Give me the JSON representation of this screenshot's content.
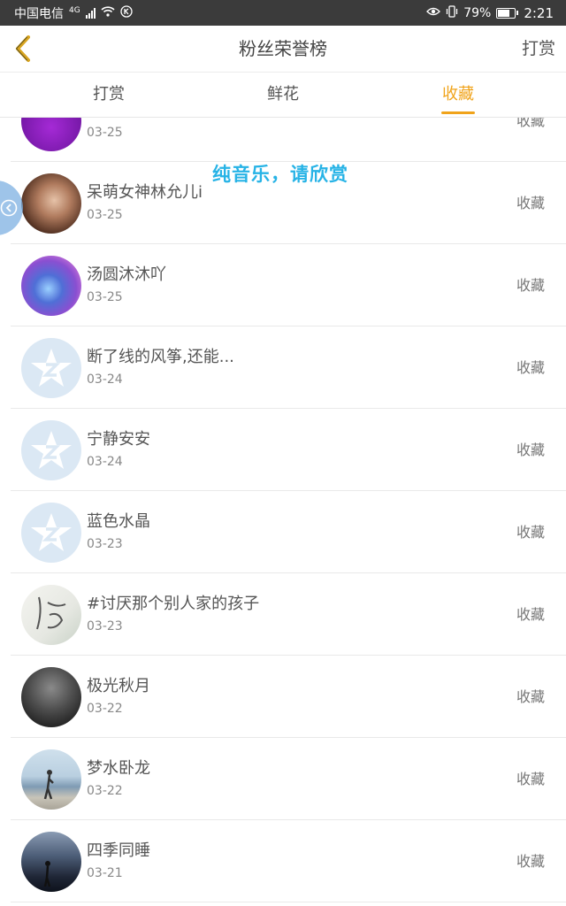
{
  "status_bar": {
    "carrier": "中国电信",
    "network": "4G",
    "battery": "79%",
    "battery_level": 0.79,
    "time": "2:21"
  },
  "header": {
    "title": "粉丝荣誉榜",
    "right_link": "打赏"
  },
  "tabs": [
    {
      "label": "打赏",
      "active": false
    },
    {
      "label": "鲜花",
      "active": false
    },
    {
      "label": "收藏",
      "active": true
    }
  ],
  "overlay_text": "纯音乐，请欣赏",
  "list": [
    {
      "name": "",
      "date": "03-25",
      "action": "收藏",
      "avatar": "purple-avatar"
    },
    {
      "name": "呆萌女神林允儿i",
      "date": "03-25",
      "action": "收藏",
      "avatar": "photo-avatar"
    },
    {
      "name": "汤圆沐沐吖",
      "date": "03-25",
      "action": "收藏",
      "avatar": "galaxy-avatar"
    },
    {
      "name": "断了线的风筝,还能...",
      "date": "03-24",
      "action": "收藏",
      "avatar": "default-star-avatar"
    },
    {
      "name": "宁静安安",
      "date": "03-24",
      "action": "收藏",
      "avatar": "default-star-avatar"
    },
    {
      "name": "蓝色水晶",
      "date": "03-23",
      "action": "收藏",
      "avatar": "default-star-avatar"
    },
    {
      "name": "#讨厌那个别人家的孩子",
      "date": "03-23",
      "action": "收藏",
      "avatar": "calligraphy-avatar"
    },
    {
      "name": "极光秋月",
      "date": "03-22",
      "action": "收藏",
      "avatar": "dark-photo-avatar"
    },
    {
      "name": "梦水卧龙",
      "date": "03-22",
      "action": "收藏",
      "avatar": "beach-avatar"
    },
    {
      "name": "四季同睡",
      "date": "03-21",
      "action": "收藏",
      "avatar": "night-avatar"
    }
  ]
}
